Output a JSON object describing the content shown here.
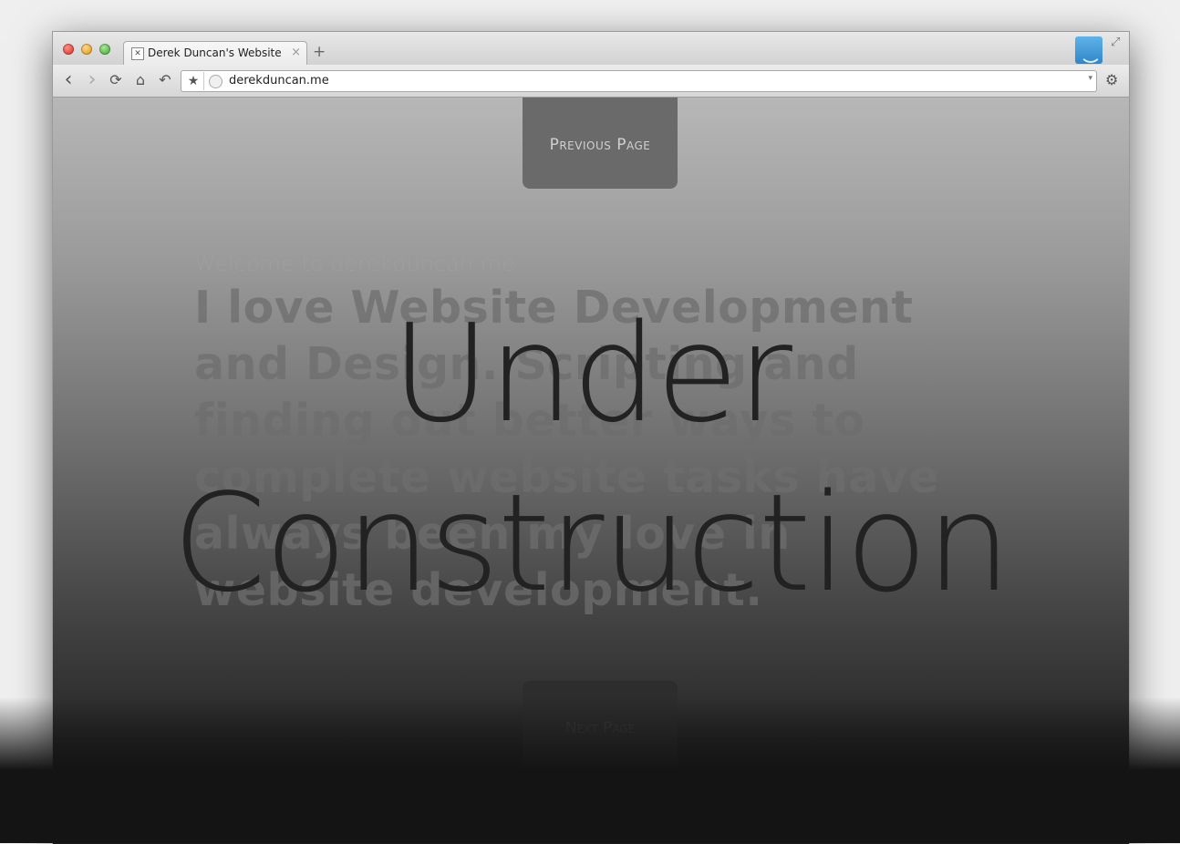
{
  "browser": {
    "tab_title": "Derek Duncan's Website",
    "tab_close": "×",
    "new_tab": "+",
    "url": "derekduncan.me",
    "toolbar": {
      "back": "‹",
      "forward": "›",
      "reload": "⟳",
      "home": "⌂",
      "undo": "↶",
      "bookmark": "★",
      "dropdown": "▾",
      "settings": "⚙"
    },
    "fullscreen": "⤢"
  },
  "page": {
    "prev_label": "Previous Page",
    "welcome": "Welcome to derekduncan.me",
    "intro": "I love Website Development and Design. Scripting and finding out better ways to complete website tasks have always been my love in website development.",
    "overlay_line1": "Under",
    "overlay_line2": "Construction",
    "next_label": "Next Page"
  }
}
